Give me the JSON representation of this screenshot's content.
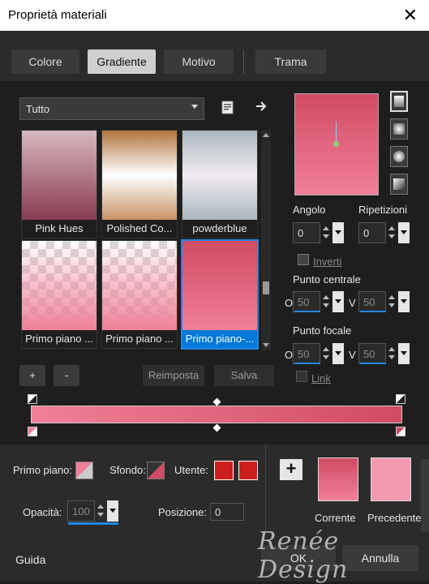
{
  "window": {
    "title": "Proprietà materiali",
    "close_glyph": "✕"
  },
  "tabs": [
    {
      "label": "Colore"
    },
    {
      "label": "Gradiente",
      "active": true
    },
    {
      "label": "Motivo"
    },
    {
      "label": "Trama"
    }
  ],
  "library": {
    "category": "Tutto",
    "items": [
      {
        "label": "Pink Hues",
        "colors": [
          "#d7b8c0",
          "#8a3c52"
        ]
      },
      {
        "label": "Polished Co...",
        "colors": [
          "#b3743e",
          "#ffffff",
          "#c89366"
        ]
      },
      {
        "label": "powderblue",
        "colors": [
          "#aab8c0",
          "#f1eaef",
          "#aab8c0"
        ]
      },
      {
        "label": "Primo piano ...",
        "colors": [
          "#ffffff",
          "#f08098"
        ]
      },
      {
        "label": "Primo piano ...",
        "colors": [
          "#ffffff",
          "#f08098"
        ]
      },
      {
        "label": "Primo piano-...",
        "colors": [
          "#d14b64",
          "#f08098"
        ],
        "selected": true
      }
    ],
    "add_label": "+",
    "remove_label": "-",
    "reset_label": "Reimposta",
    "save_label": "Salva"
  },
  "properties": {
    "angle_label": "Angolo",
    "angle_value": "0",
    "repeats_label": "Ripetizioni",
    "repeats_value": "0",
    "invert_label": "Inverti",
    "invert_checked": false,
    "center_label": "Punto centrale",
    "center_h_label": "O",
    "center_h_value": "50",
    "center_v_label": "V",
    "center_v_value": "50",
    "focal_label": "Punto focale",
    "focal_h_label": "O",
    "focal_h_value": "50",
    "focal_v_label": "V",
    "focal_v_value": "50",
    "link_label": "Link",
    "link_checked": false
  },
  "gradient_editor": {
    "start_color": "#f08098",
    "end_color": "#d14b64"
  },
  "bottom": {
    "foreground_label": "Primo piano:",
    "background_label": "Sfondo:",
    "user_label": "Utente:",
    "opacity_label": "Opacità:",
    "opacity_value": "100",
    "position_label": "Posizione:",
    "position_value": "0",
    "current_label": "Corrente",
    "previous_label": "Precedente",
    "user_color_1": "#cc1e1e",
    "user_color_2": "#cc1e1e",
    "current_colors": [
      "#d14b64",
      "#f08098"
    ],
    "previous_color": "#f39ab0",
    "plus_label": "+",
    "watermark": "Renée Design"
  },
  "footer": {
    "help_label": "Guida",
    "ok_label": "OK",
    "cancel_label": "Annulla"
  }
}
